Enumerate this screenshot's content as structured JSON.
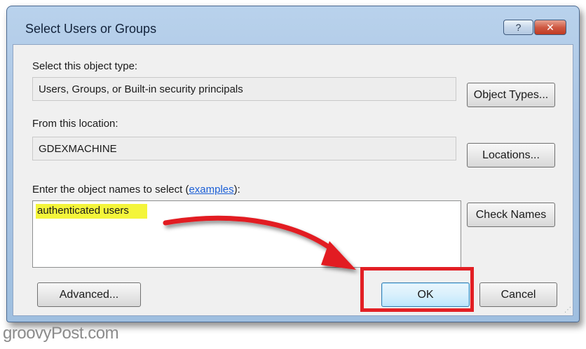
{
  "window": {
    "title": "Select Users or Groups",
    "help_glyph": "?",
    "close_glyph": "✕"
  },
  "object_type": {
    "label": "Select this object type:",
    "value": "Users, Groups, or Built-in security principals",
    "button": "Object Types..."
  },
  "location": {
    "label": "From this location:",
    "value": "GDEXMACHINE",
    "button": "Locations..."
  },
  "object_names": {
    "label_prefix": "Enter the object names to select (",
    "link": "examples",
    "label_suffix": "):",
    "value": "authenticated users",
    "check_button": "Check Names"
  },
  "buttons": {
    "advanced": "Advanced...",
    "ok": "OK",
    "cancel": "Cancel"
  },
  "annotation": {
    "highlight_color": "#e21f24",
    "arrow_color": "#e21f24",
    "text_highlight_color": "#f4f53a"
  },
  "watermark": "groovyPost.com"
}
